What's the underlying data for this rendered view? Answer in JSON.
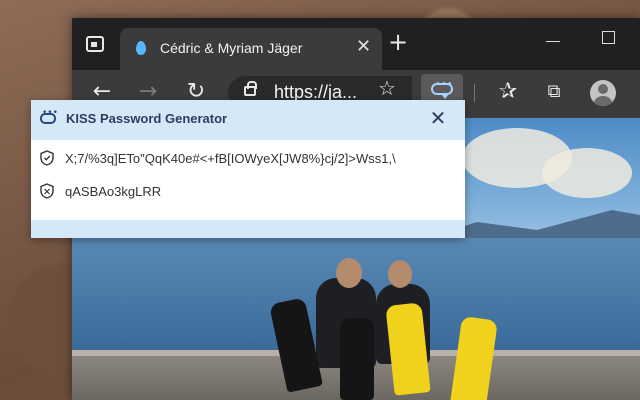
{
  "browser": {
    "tab": {
      "title": "Cédric & Myriam Jäger"
    },
    "address": {
      "url": "https://ja..."
    }
  },
  "extension_popup": {
    "title": "KISS Password Generator",
    "passwords": [
      {
        "icon": "shield-check-icon",
        "value": "X;7/%3q]ETo\"QqK40e#<+fB[IOWyeX[JW8%}cj/2]>Wss1,\\"
      },
      {
        "icon": "shield-plain-icon",
        "value": "qASBAo3kgLRR"
      }
    ]
  },
  "colors": {
    "popup_header": "#d5e8f8",
    "popup_title": "#2b3e5e",
    "toolbar": "#3b3b3b",
    "titlebar": "#202020"
  }
}
